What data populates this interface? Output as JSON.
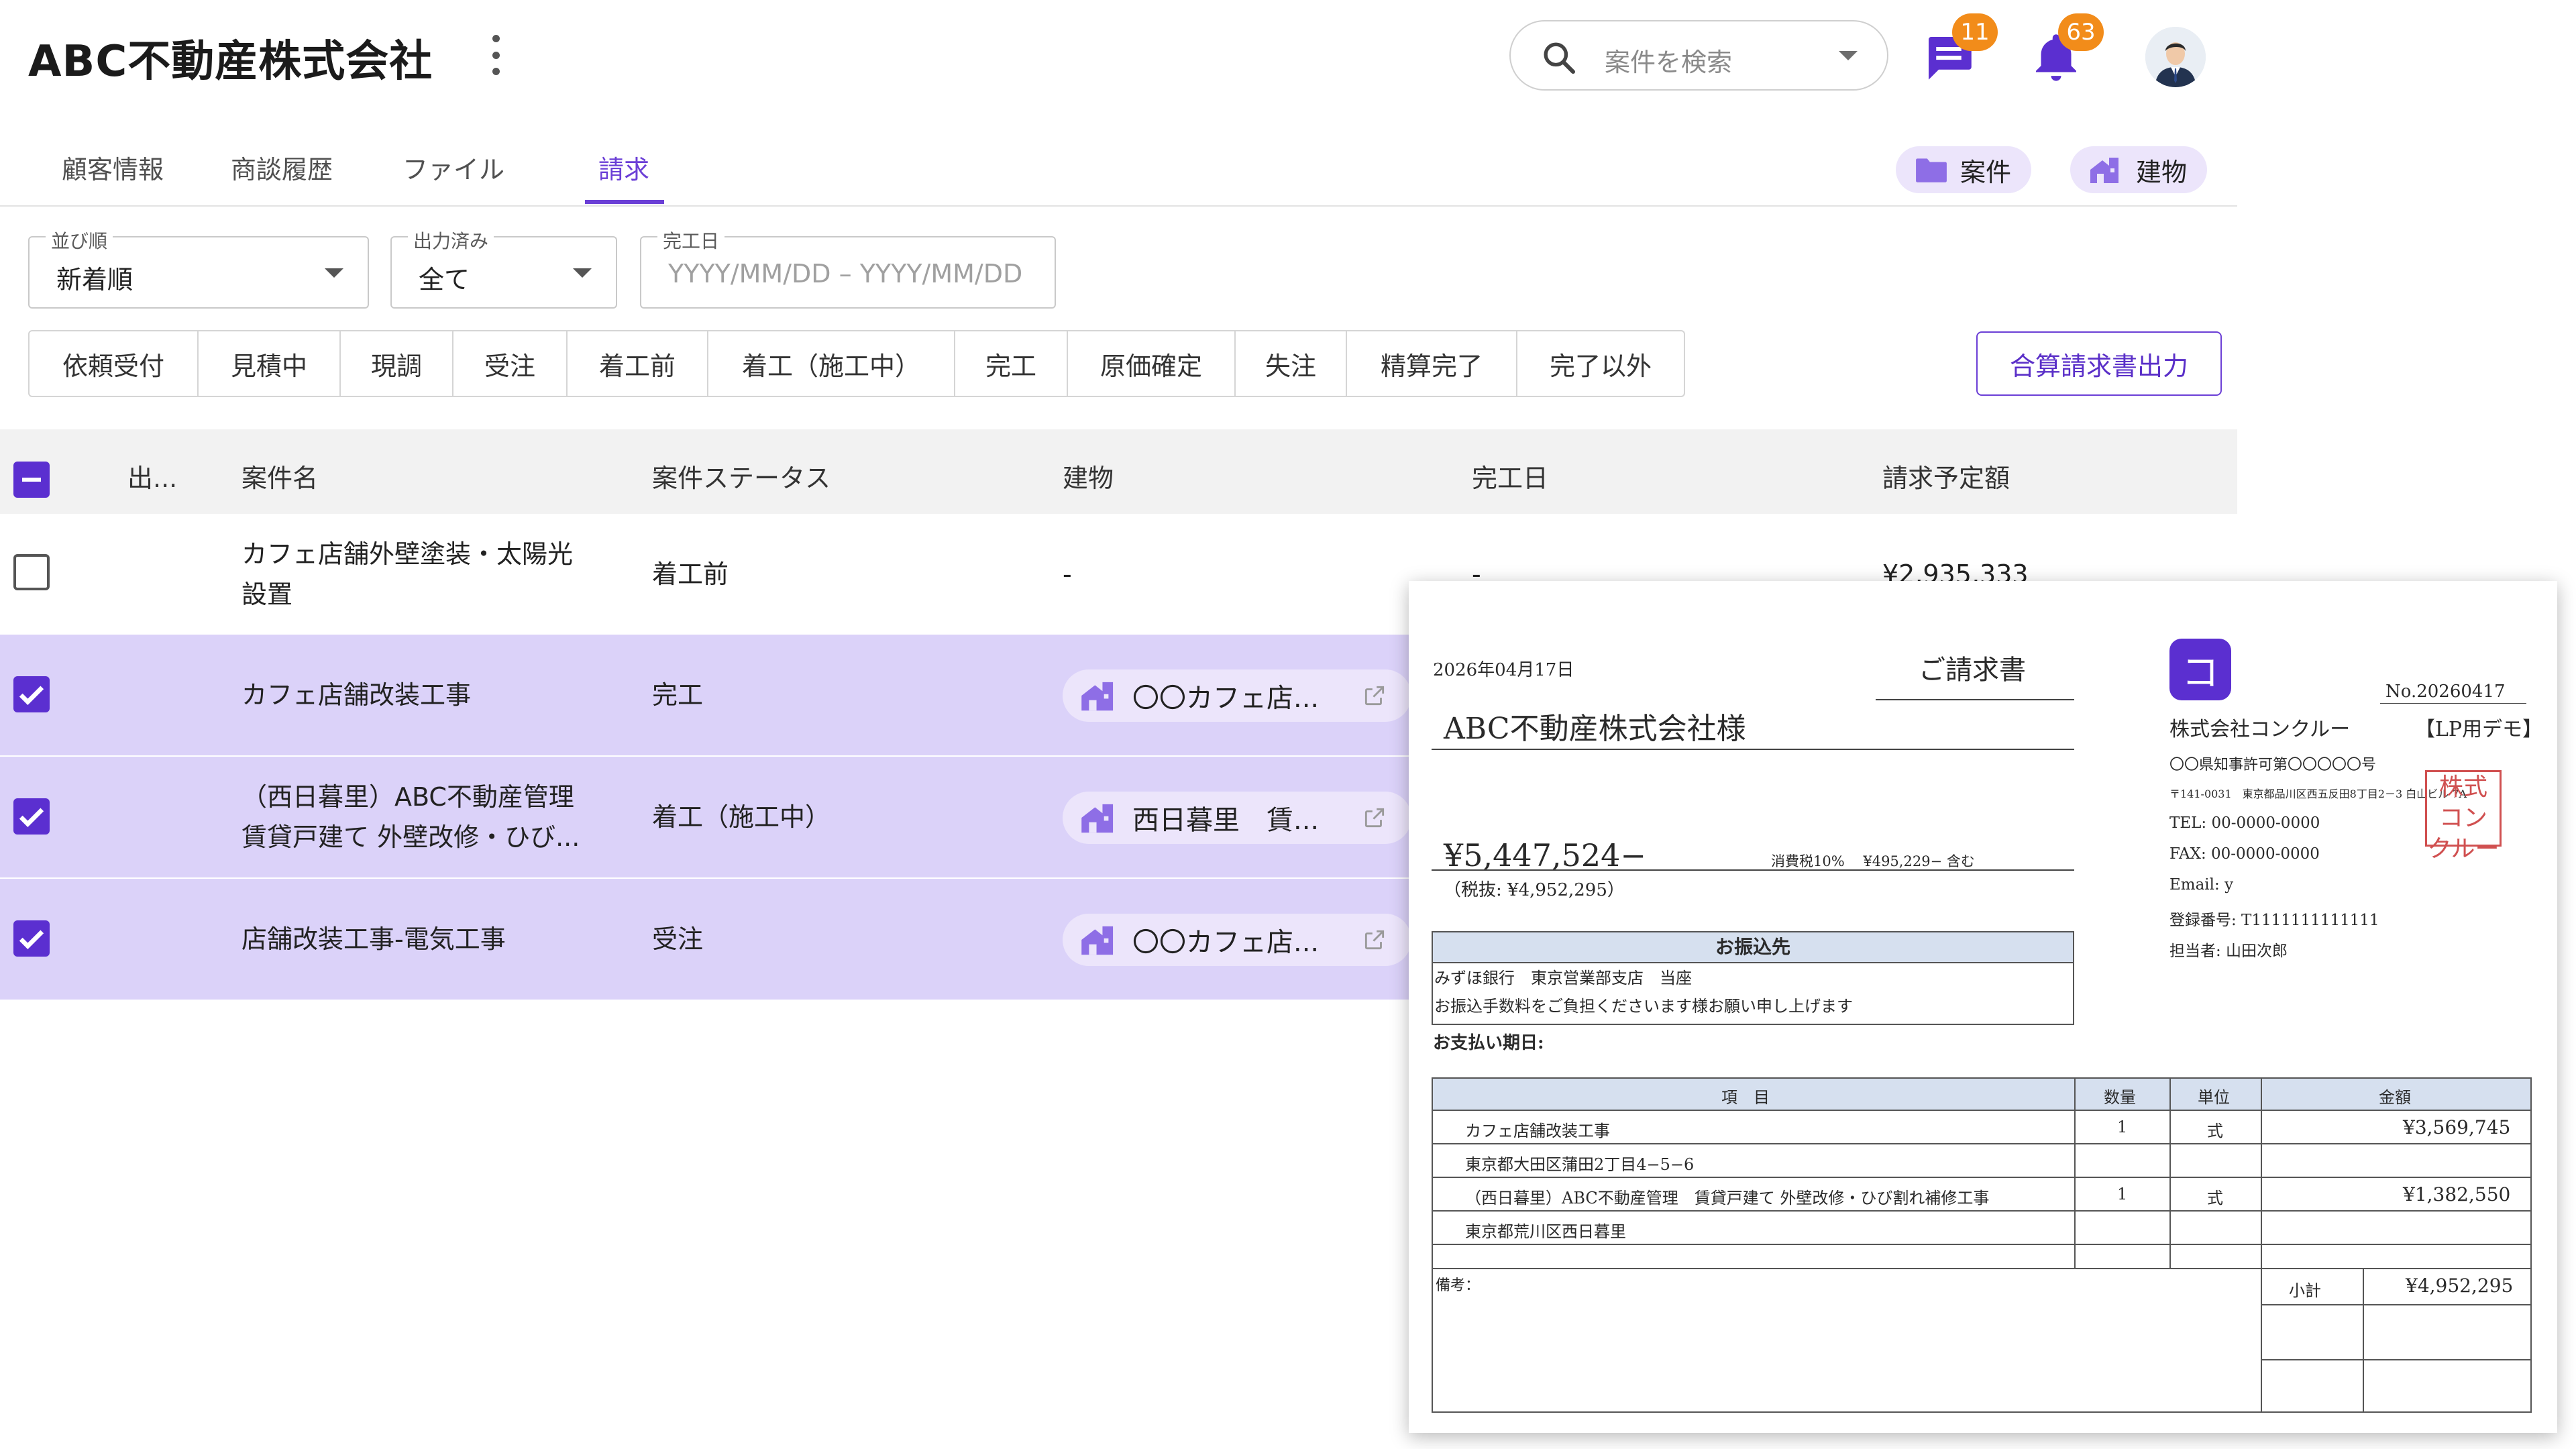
{
  "header": {
    "title": "ABC不動産株式会社",
    "search_placeholder": "案件を検索",
    "chat_badge": "11",
    "notification_badge": "63"
  },
  "tabs": [
    "顧客情報",
    "商談履歴",
    "ファイル",
    "請求"
  ],
  "active_tab": "請求",
  "chips": {
    "project": "案件",
    "building": "建物"
  },
  "filters": {
    "sort": {
      "label": "並び順",
      "value": "新着順"
    },
    "output": {
      "label": "出力済み",
      "value": "全て"
    },
    "completion": {
      "label": "完工日",
      "placeholder": "YYYY/MM/DD – YYYY/MM/DD"
    }
  },
  "status_filters": [
    "依頼受付",
    "見積中",
    "現調",
    "受注",
    "着工前",
    "着工（施工中）",
    "完工",
    "原価確定",
    "失注",
    "精算完了",
    "完了以外"
  ],
  "merge_button": "合算請求書出力",
  "table": {
    "columns": [
      "出...",
      "案件名",
      "案件ステータス",
      "建物",
      "完工日",
      "請求予定額"
    ],
    "rows": [
      {
        "checked": false,
        "name_line1": "カフェ店舗外壁塗装・太陽光",
        "name_line2": "設置",
        "status": "着工前",
        "building": "-",
        "completion": "-",
        "amount": "¥2,935,333"
      },
      {
        "checked": true,
        "name_line1": "カフェ店舗改装工事",
        "name_line2": "",
        "status": "完工",
        "building": "〇〇カフェ店...",
        "completion": "",
        "amount": ""
      },
      {
        "checked": true,
        "name_line1": "（西日暮里）ABC不動産管理",
        "name_line2": "賃貸戸建て 外壁改修・ひび...",
        "status": "着工（施工中）",
        "building": "西日暮里　賃...",
        "completion": "",
        "amount": ""
      },
      {
        "checked": true,
        "name_line1": "店舗改装工事-電気工事",
        "name_line2": "",
        "status": "受注",
        "building": "〇〇カフェ店...",
        "completion": "",
        "amount": ""
      }
    ]
  },
  "invoice": {
    "date": "2026年04月17日",
    "doc_title": "ご請求書",
    "number": "No.20260417",
    "addressee": "ABC不動産株式会社様",
    "logo_char": "コ",
    "issuer": "株式会社コンクルー",
    "issuer_tag": "【LP用デモ】",
    "license": "〇〇県知事許可第〇〇〇〇〇号",
    "address": "〒141-0031　東京都品川区西五反田8丁目2－3 白山ビル 7A",
    "tel": "TEL: 00-0000-0000",
    "fax": "FAX: 00-0000-0000",
    "email": "Email: y",
    "registration": "登録番号: T1111111111111",
    "person": "担当者: 山田次郎",
    "stamp": "株式コンクルー",
    "total": "¥5,447,524−",
    "tax_note": "消費税10%　 ¥495,229− 含む",
    "pretax": "（税抜: ¥4,952,295）",
    "bank_title": "お振込先",
    "bank_line1": "みずほ銀行　東京営業部支店　当座",
    "bank_line2": "お振込手数料をご負担くださいます様お願い申し上げます",
    "due_label": "お支払い期日:",
    "item_headers": [
      "項　目",
      "数量",
      "単位",
      "金額"
    ],
    "items": [
      {
        "name": "カフェ店舗改装工事",
        "qty": "1",
        "unit": "式",
        "amount": "¥3,569,745"
      },
      {
        "name": "東京都大田区蒲田2丁目4−5−6",
        "qty": "",
        "unit": "",
        "amount": ""
      },
      {
        "name": "（西日暮里）ABC不動産管理　賃貸戸建て 外壁改修・ひび割れ補修工事",
        "qty": "1",
        "unit": "式",
        "amount": "¥1,382,550"
      },
      {
        "name": "東京都荒川区西日暮里",
        "qty": "",
        "unit": "",
        "amount": ""
      }
    ],
    "remarks_label": "備考：",
    "subtotal_label": "小計",
    "subtotal": "¥4,952,295"
  }
}
